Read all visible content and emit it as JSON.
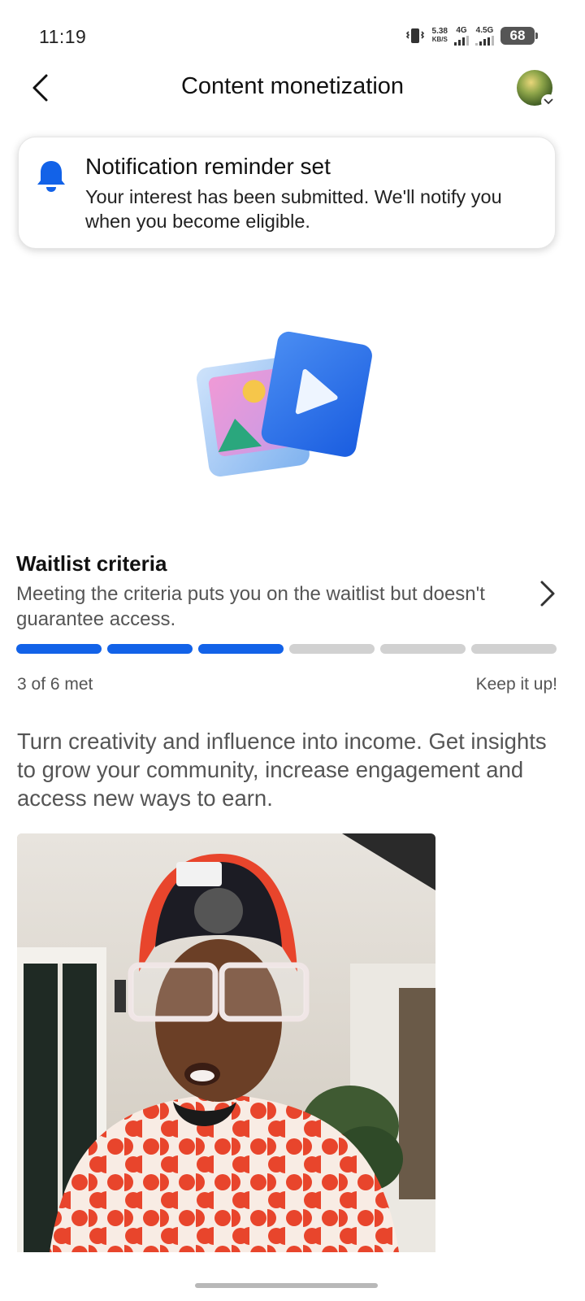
{
  "status_bar": {
    "time": "11:19",
    "speed_value": "5.38",
    "speed_unit": "KB/S",
    "network_1": "4G",
    "network_2": "4.5G",
    "battery": "68"
  },
  "header": {
    "back_icon": "chevron-left-icon",
    "title": "Content monetization",
    "avatar_icon": "profile-avatar"
  },
  "toast": {
    "icon": "bell-icon",
    "title": "Notification reminder set",
    "text": "Your interest has been submitted. We'll notify you when you become eligible."
  },
  "hero": {
    "icon": "photo-video-illustration"
  },
  "criteria": {
    "title": "Waitlist criteria",
    "text": "Meeting the criteria puts you on the waitlist but doesn't guarantee access.",
    "chevron_icon": "chevron-right-icon",
    "met": 3,
    "total": 6,
    "progress_label": "3 of 6 met",
    "encouragement": "Keep it up!"
  },
  "description": "Turn creativity and influence into income. Get insights to grow your community, increase engagement and access new ways to earn.",
  "colors": {
    "accent": "#1262e8",
    "inactive_segment": "#d1d1d1",
    "secondary_text": "#555555"
  }
}
